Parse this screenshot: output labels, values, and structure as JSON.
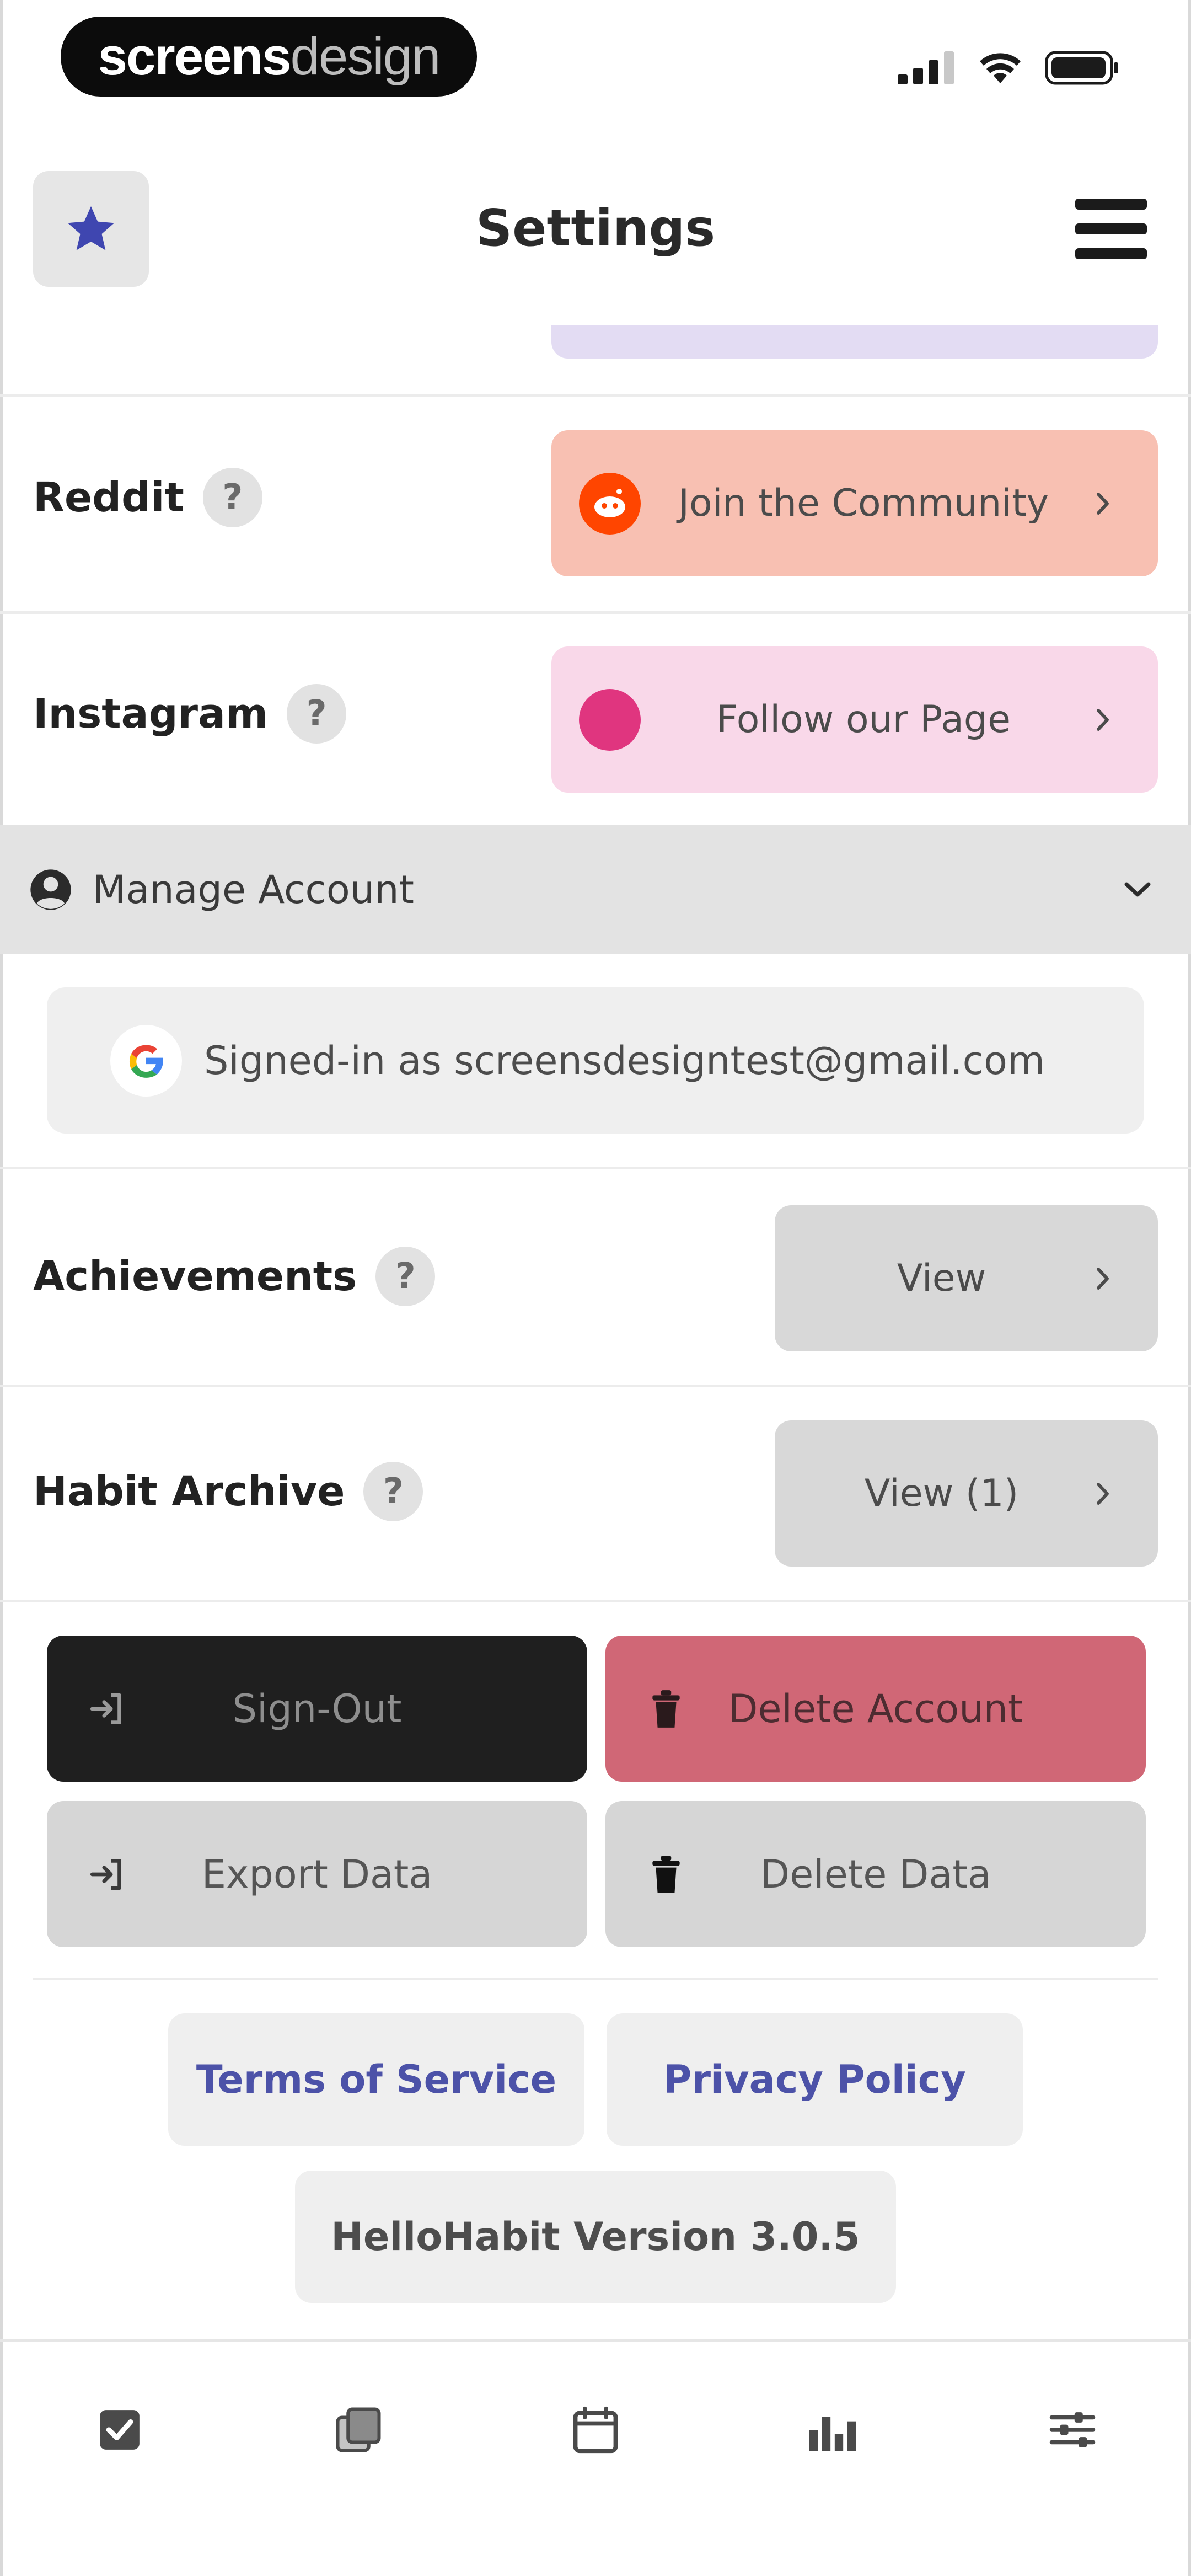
{
  "status_bar": {
    "brand_bold": "screens",
    "brand_light": "design"
  },
  "header": {
    "title": "Settings",
    "star_icon": "star-icon",
    "menu_icon": "hamburger-menu-icon"
  },
  "social": {
    "reddit": {
      "label": "Reddit",
      "help": "?",
      "button_label": "Join the Community",
      "brand_color": "#ff4500"
    },
    "instagram": {
      "label": "Instagram",
      "help": "?",
      "button_label": "Follow our Page",
      "brand_color": "#e0357f"
    }
  },
  "manage_account": {
    "title": "Manage Account",
    "signed_in_text": "Signed-in as screensdesigntest@gmail.com"
  },
  "achievements": {
    "label": "Achievements",
    "help": "?",
    "button_label": "View"
  },
  "habit_archive": {
    "label": "Habit Archive",
    "help": "?",
    "button_label": "View (1)"
  },
  "account_actions": {
    "sign_out": "Sign-Out",
    "delete_account": "Delete Account",
    "export_data": "Export Data",
    "delete_data": "Delete Data"
  },
  "footer": {
    "terms": "Terms of Service",
    "privacy": "Privacy Policy",
    "version": "HelloHabit Version 3.0.5"
  },
  "tabs": [
    {
      "icon": "checkbox-icon"
    },
    {
      "icon": "notes-icon"
    },
    {
      "icon": "calendar-icon"
    },
    {
      "icon": "stats-icon"
    },
    {
      "icon": "sliders-icon"
    }
  ],
  "colors": {
    "accent": "#4c52a8",
    "danger": "#d06776",
    "dark_button": "#1f1f1f"
  }
}
